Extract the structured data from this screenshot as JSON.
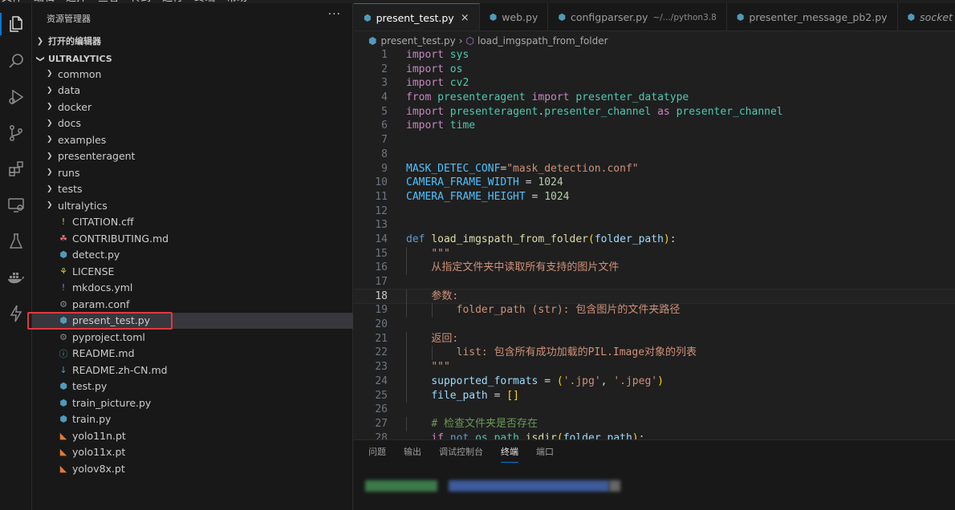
{
  "menu": [
    "文件",
    "编辑",
    "选择",
    "查看",
    "转到",
    "运行",
    "终端",
    "帮助"
  ],
  "sidebar": {
    "title": "资源管理器",
    "more": "···",
    "open_editors": "打开的编辑器",
    "project": "ULTRALYTICS",
    "items": [
      {
        "label": "common",
        "type": "folder"
      },
      {
        "label": "data",
        "type": "folder"
      },
      {
        "label": "docker",
        "type": "folder"
      },
      {
        "label": "docs",
        "type": "folder"
      },
      {
        "label": "examples",
        "type": "folder"
      },
      {
        "label": "presenteragent",
        "type": "folder"
      },
      {
        "label": "runs",
        "type": "folder"
      },
      {
        "label": "tests",
        "type": "folder"
      },
      {
        "label": "ultralytics",
        "type": "folder"
      },
      {
        "label": "CITATION.cff",
        "type": "cff"
      },
      {
        "label": "CONTRIBUTING.md",
        "type": "contrib"
      },
      {
        "label": "detect.py",
        "type": "py"
      },
      {
        "label": "LICENSE",
        "type": "license"
      },
      {
        "label": "mkdocs.yml",
        "type": "yml"
      },
      {
        "label": "param.conf",
        "type": "gear"
      },
      {
        "label": "present_test.py",
        "type": "py",
        "selected": true
      },
      {
        "label": "pyproject.toml",
        "type": "gear"
      },
      {
        "label": "README.md",
        "type": "info"
      },
      {
        "label": "README.zh-CN.md",
        "type": "md"
      },
      {
        "label": "test.py",
        "type": "py"
      },
      {
        "label": "train_picture.py",
        "type": "py"
      },
      {
        "label": "train.py",
        "type": "py"
      },
      {
        "label": "yolo11n.pt",
        "type": "rss"
      },
      {
        "label": "yolo11x.pt",
        "type": "rss"
      },
      {
        "label": "yolov8x.pt",
        "type": "rss"
      }
    ]
  },
  "tabs": [
    {
      "label": "present_test.py",
      "active": true,
      "close": "×"
    },
    {
      "label": "web.py"
    },
    {
      "label": "configparser.py",
      "hint": "~/.../python3.8"
    },
    {
      "label": "presenter_message_pb2.py"
    },
    {
      "label": "socket"
    }
  ],
  "breadcrumb": {
    "file": "present_test.py",
    "symbol": "load_imgspath_from_folder"
  },
  "code": {
    "current_line": 18,
    "lines": [
      [
        [
          "kw",
          "import"
        ],
        [
          "pl",
          " "
        ],
        [
          "mod",
          "sys"
        ]
      ],
      [
        [
          "kw",
          "import"
        ],
        [
          "pl",
          " "
        ],
        [
          "mod",
          "os"
        ]
      ],
      [
        [
          "kw",
          "import"
        ],
        [
          "pl",
          " "
        ],
        [
          "mod",
          "cv2"
        ]
      ],
      [
        [
          "kw",
          "from"
        ],
        [
          "pl",
          " "
        ],
        [
          "mod",
          "presenteragent"
        ],
        [
          "pl",
          " "
        ],
        [
          "kw",
          "import"
        ],
        [
          "pl",
          " "
        ],
        [
          "mod",
          "presenter_datatype"
        ]
      ],
      [
        [
          "kw",
          "import"
        ],
        [
          "pl",
          " "
        ],
        [
          "mod",
          "presenteragent"
        ],
        [
          "pl",
          "."
        ],
        [
          "mod",
          "presenter_channel"
        ],
        [
          "pl",
          " "
        ],
        [
          "kw",
          "as"
        ],
        [
          "pl",
          " "
        ],
        [
          "mod",
          "presenter_channel"
        ]
      ],
      [
        [
          "kw",
          "import"
        ],
        [
          "pl",
          " "
        ],
        [
          "mod",
          "time"
        ]
      ],
      [],
      [],
      [
        [
          "cn",
          "MASK_DETEC_CONF"
        ],
        [
          "pl",
          "="
        ],
        [
          "str",
          "\"mask_detection.conf\""
        ]
      ],
      [
        [
          "cn",
          "CAMERA_FRAME_WIDTH"
        ],
        [
          "pl",
          " = "
        ],
        [
          "num",
          "1024"
        ]
      ],
      [
        [
          "cn",
          "CAMERA_FRAME_HEIGHT"
        ],
        [
          "pl",
          " = "
        ],
        [
          "num",
          "1024"
        ]
      ],
      [],
      [],
      [
        [
          "kw2",
          "def"
        ],
        [
          "pl",
          " "
        ],
        [
          "fn",
          "load_imgspath_from_folder"
        ],
        [
          "br",
          "("
        ],
        [
          "var",
          "folder_path"
        ],
        [
          "br",
          ")"
        ],
        [
          "pl",
          ":"
        ]
      ],
      [
        [
          "pl",
          "    "
        ],
        [
          "str",
          "\"\"\""
        ]
      ],
      [
        [
          "pl",
          "    "
        ],
        [
          "str",
          "从指定文件夹中读取所有支持的图片文件"
        ]
      ],
      [],
      [
        [
          "pl",
          "    "
        ],
        [
          "str",
          "参数:"
        ]
      ],
      [
        [
          "pl",
          "        "
        ],
        [
          "str",
          "folder_path (str): 包含图片的文件夹路径"
        ]
      ],
      [],
      [
        [
          "pl",
          "    "
        ],
        [
          "str",
          "返回:"
        ]
      ],
      [
        [
          "pl",
          "        "
        ],
        [
          "str",
          "list: 包含所有成功加载的PIL.Image对象的列表"
        ]
      ],
      [
        [
          "pl",
          "    "
        ],
        [
          "str",
          "\"\"\""
        ]
      ],
      [
        [
          "pl",
          "    "
        ],
        [
          "var",
          "supported_formats"
        ],
        [
          "pl",
          " = "
        ],
        [
          "br",
          "("
        ],
        [
          "str",
          "'.jpg'"
        ],
        [
          "pl",
          ", "
        ],
        [
          "str",
          "'.jpeg'"
        ],
        [
          "br",
          ")"
        ]
      ],
      [
        [
          "pl",
          "    "
        ],
        [
          "var",
          "file_path"
        ],
        [
          "pl",
          " = "
        ],
        [
          "br",
          "[]"
        ]
      ],
      [],
      [
        [
          "pl",
          "    "
        ],
        [
          "cm",
          "# 检查文件夹是否存在"
        ]
      ],
      [
        [
          "pl",
          "    "
        ],
        [
          "kw",
          "if"
        ],
        [
          "pl",
          " "
        ],
        [
          "kw2",
          "not"
        ],
        [
          "pl",
          " "
        ],
        [
          "mod",
          "os"
        ],
        [
          "pl",
          "."
        ],
        [
          "mod",
          "path"
        ],
        [
          "pl",
          "."
        ],
        [
          "fn",
          "isdir"
        ],
        [
          "br",
          "("
        ],
        [
          "var",
          "folder_path"
        ],
        [
          "br",
          ")"
        ],
        [
          "pl",
          ":"
        ]
      ]
    ]
  },
  "panel": {
    "tabs": [
      "问题",
      "输出",
      "调试控制台",
      "终端",
      "端口"
    ],
    "active": "终端"
  }
}
